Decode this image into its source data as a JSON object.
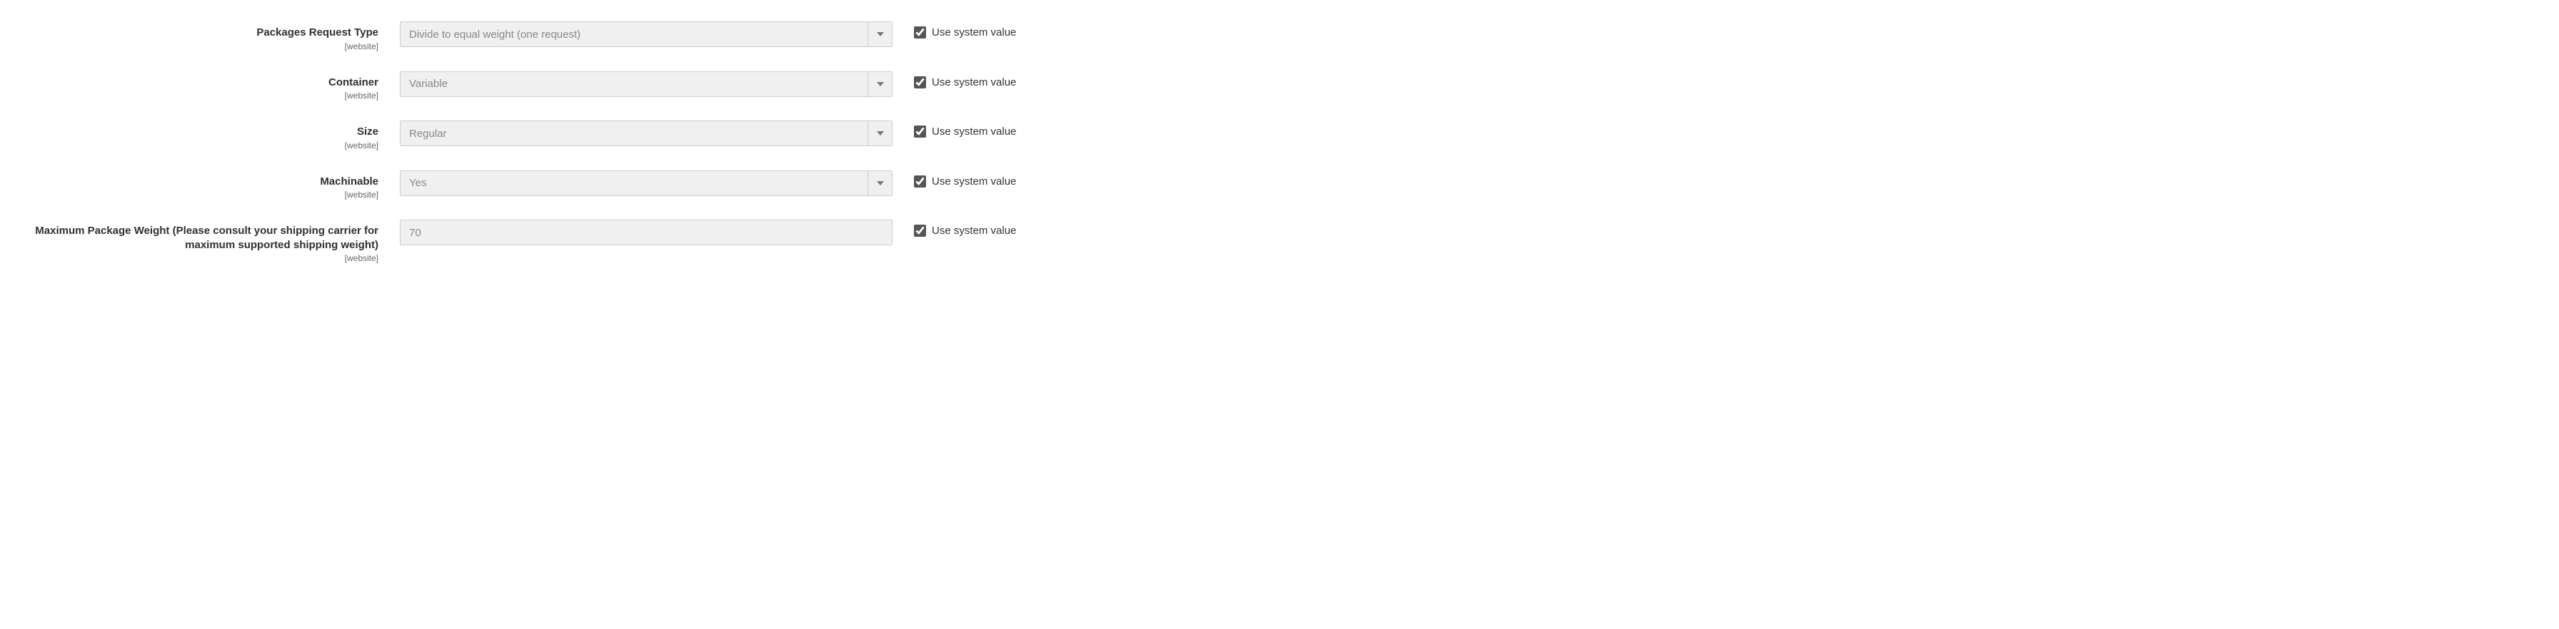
{
  "scope_label": "[website]",
  "use_system_label": "Use system value",
  "rows": {
    "packages_request_type": {
      "label": "Packages Request Type",
      "value": "Divide to equal weight (one request)",
      "type": "select",
      "use_system": true
    },
    "container": {
      "label": "Container",
      "value": "Variable",
      "type": "select",
      "use_system": true
    },
    "size": {
      "label": "Size",
      "value": "Regular",
      "type": "select",
      "use_system": true
    },
    "machinable": {
      "label": "Machinable",
      "value": "Yes",
      "type": "select",
      "use_system": true
    },
    "max_package_weight": {
      "label": "Maximum Package Weight (Please consult your shipping carrier for maximum supported shipping weight)",
      "value": "70",
      "type": "text",
      "use_system": true
    }
  }
}
